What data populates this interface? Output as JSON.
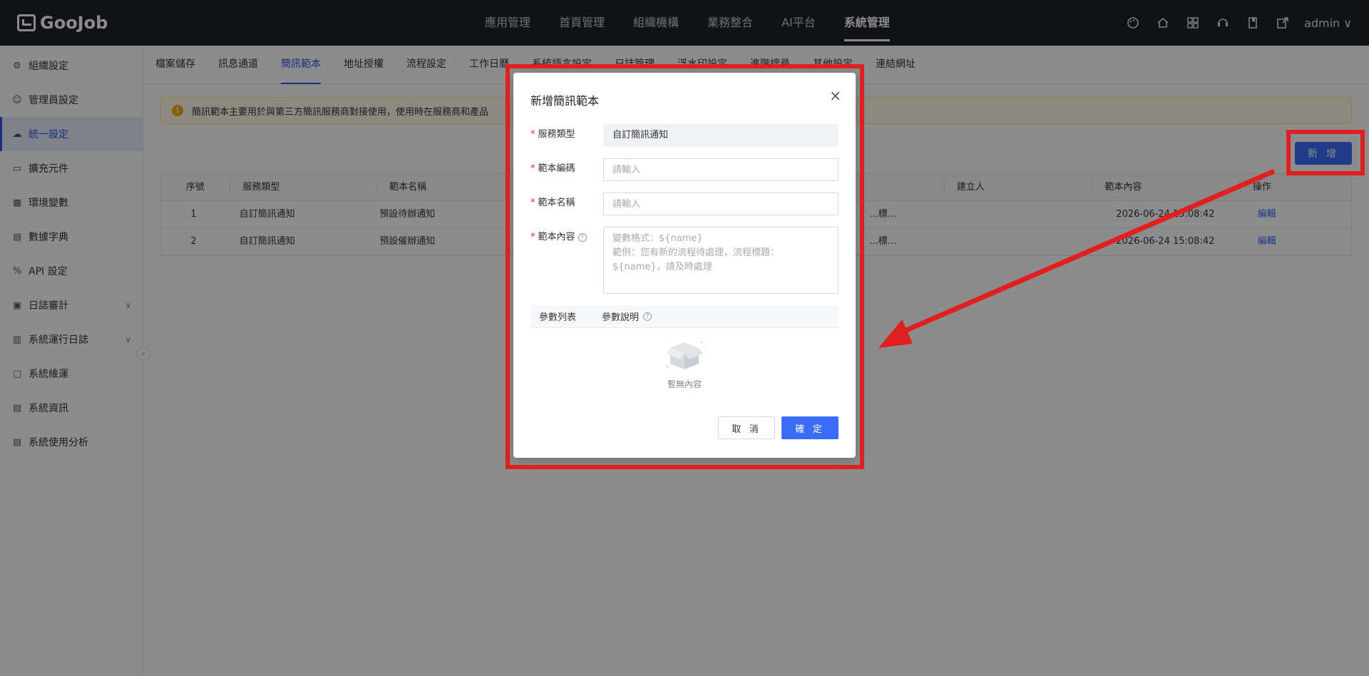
{
  "header": {
    "logo": "GooJob",
    "nav": [
      "應用管理",
      "首頁管理",
      "組織機構",
      "業務整合",
      "AI平台",
      "系統管理"
    ],
    "active_nav": 5,
    "icons": [
      "palette-icon",
      "home-icon",
      "apps-icon",
      "support-icon",
      "book-icon",
      "export-icon"
    ],
    "user": "admin ∨"
  },
  "sidebar": {
    "items": [
      {
        "label": "組織設定",
        "icon": "gear-icon"
      },
      {
        "label": "管理員設定",
        "icon": "user-icon"
      },
      {
        "label": "統一設定",
        "icon": "cloud-icon"
      },
      {
        "label": "擴充元件",
        "icon": "box-icon"
      },
      {
        "label": "環境變數",
        "icon": "keyboard-icon"
      },
      {
        "label": "數據字典",
        "icon": "dictionary-icon"
      },
      {
        "label": "API 設定",
        "icon": "percent-icon"
      },
      {
        "label": "日誌審計",
        "icon": "audit-icon"
      },
      {
        "label": "系統運行日誌",
        "icon": "log-icon"
      },
      {
        "label": "系統維運",
        "icon": "maintenance-icon"
      },
      {
        "label": "系統資訊",
        "icon": "info-icon"
      },
      {
        "label": "系統使用分析",
        "icon": "analysis-icon"
      }
    ],
    "active_index": 2,
    "collapse": "‹"
  },
  "tabs": [
    "檔案儲存",
    "訊息通道",
    "簡訊範本",
    "地址授權",
    "流程設定",
    "工作日曆",
    "系統語言設定",
    "日誌管理",
    "浮水印設定",
    "進階搜尋",
    "其他設定",
    "連結網址"
  ],
  "active_tab": 2,
  "notice": {
    "icon": "!",
    "text": "簡訊範本主要用於與第三方簡訊服務商對接使用，使用時在服務商和產品"
  },
  "add_button": "新 增",
  "table": {
    "headers": [
      "序號",
      "服務類型",
      "範本名稱",
      "",
      "建立人",
      "範本內容",
      "操作"
    ],
    "rows": [
      [
        "1",
        "自訂簡訊通知",
        "預設待辦通知",
        "...標...",
        "",
        "2026-06-24 15:08:42",
        "編輯"
      ],
      [
        "2",
        "自訂簡訊通知",
        "預設催辦通知",
        "...標...",
        "",
        "2026-06-24 15:08:42",
        "編輯"
      ]
    ]
  },
  "modal": {
    "title": "新增簡訊範本",
    "close": "×",
    "required_mark": "*",
    "service_type_label": "服務類型",
    "service_type_value": "自訂簡訊通知",
    "code_label": "範本編碼",
    "code_placeholder": "請輸入",
    "name_label": "範本名稱",
    "name_placeholder": "請輸入",
    "content_label": "範本內容",
    "content_placeholder": "變數格式：${name}\n範例：您有新的流程待處理，流程標題：${name}，請及時處理",
    "help": "?",
    "param_list": "參數列表",
    "param_desc": "參數說明",
    "empty_text": "暫無內容",
    "cancel": "取 消",
    "ok": "確 定"
  }
}
